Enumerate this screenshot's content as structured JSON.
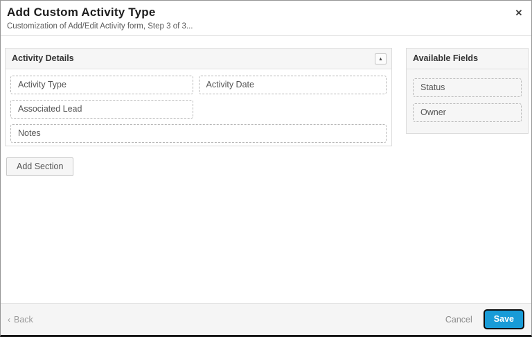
{
  "dialog": {
    "title": "Add Custom Activity Type",
    "subtitle": "Customization of Add/Edit Activity form, Step 3 of 3..."
  },
  "icons": {
    "close": "✕",
    "collapse": "▲",
    "back_chevron": "‹"
  },
  "activity_details": {
    "title": "Activity Details",
    "fields": [
      "Activity Type",
      "Activity Date",
      "Associated Lead",
      "Notes"
    ]
  },
  "available_fields": {
    "title": "Available Fields",
    "fields": [
      "Status",
      "Owner"
    ]
  },
  "buttons": {
    "add_section": "Add Section",
    "back": "Back",
    "cancel": "Cancel",
    "save": "Save"
  },
  "colors": {
    "save_button_bg": "#189bd7",
    "save_button_text": "#ffffff",
    "panel_header_bg": "#f6f6f6",
    "dashed_border": "#b7b7b7"
  }
}
